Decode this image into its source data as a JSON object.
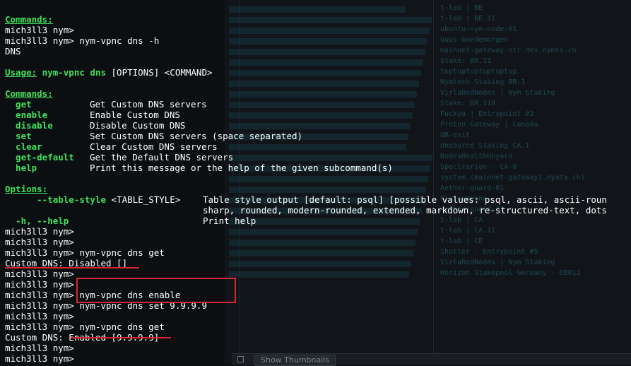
{
  "terminal": {
    "prompt": "mich3ll3 nym>",
    "lines": [
      {
        "kind": "heading",
        "text": "Commands:"
      },
      {
        "kind": "prompt",
        "cmd": ""
      },
      {
        "kind": "prompt",
        "cmd": " nym-vpnc dns -h"
      },
      {
        "kind": "text",
        "text": "DNS"
      },
      {
        "kind": "blank"
      },
      {
        "kind": "usage",
        "label": "Usage:",
        "bold": " nym-vpnc dns",
        "rest": " [OPTIONS] <COMMAND>"
      },
      {
        "kind": "blank"
      },
      {
        "kind": "heading",
        "text": "Commands:"
      },
      {
        "kind": "command",
        "name": "  get",
        "desc": "Get Custom DNS servers"
      },
      {
        "kind": "command",
        "name": "  enable",
        "desc": "Enable Custom DNS"
      },
      {
        "kind": "command",
        "name": "  disable",
        "desc": "Disable Custom DNS"
      },
      {
        "kind": "command",
        "name": "  set",
        "desc": "Set Custom DNS servers (space separated)"
      },
      {
        "kind": "command",
        "name": "  clear",
        "desc": "Clear Custom DNS servers"
      },
      {
        "kind": "command",
        "name": "  get-default",
        "desc": "Get the Default DNS servers"
      },
      {
        "kind": "command",
        "name": "  help",
        "desc": "Print this message or the help of the given subcommand(s)"
      },
      {
        "kind": "blank"
      },
      {
        "kind": "heading",
        "text": "Options:"
      },
      {
        "kind": "option",
        "name": "      --table-style",
        "arg": " <TABLE_STYLE>",
        "desc": "Table style output [default: psql] [possible values: psql, ascii, ascii-roun"
      },
      {
        "kind": "continuation",
        "text": "sharp, rounded, modern-rounded, extended, markdown, re-structured-text, dots"
      },
      {
        "kind": "option",
        "name": "  -h, --help",
        "arg": "",
        "desc": "Print help"
      },
      {
        "kind": "prompt",
        "cmd": ""
      },
      {
        "kind": "prompt",
        "cmd": ""
      },
      {
        "kind": "prompt",
        "cmd": " nym-vpnc dns get"
      },
      {
        "kind": "text",
        "text": "Custom DNS: Disabled []"
      },
      {
        "kind": "prompt",
        "cmd": ""
      },
      {
        "kind": "prompt",
        "cmd": ""
      },
      {
        "kind": "prompt",
        "cmd": " nym-vpnc dns enable"
      },
      {
        "kind": "prompt",
        "cmd": " nym-vpnc dns set 9.9.9.9"
      },
      {
        "kind": "prompt",
        "cmd": ""
      },
      {
        "kind": "prompt",
        "cmd": " nym-vpnc dns get"
      },
      {
        "kind": "text",
        "text": "Custom DNS: Enabled [9.9.9.9]"
      },
      {
        "kind": "prompt",
        "cmd": ""
      },
      {
        "kind": "prompt",
        "cmd": ""
      }
    ]
  },
  "background": {
    "thumbnails_label": "Show Thumbnails",
    "rows": [
      "t-lab | BE",
      "t-lab | BE.II",
      "ubuntu-nym-node-01",
      "Guus Goedemorgen",
      "mainnet-gateway-ntr.dev.nymte.ch",
      "Stake: BR.II",
      "tuptuptuptuptuptup",
      "Nymtech Staking BR.1",
      "VirlaRedNodes | Nym Staking",
      "Stake: BR.118",
      "Fuckya | Entrypoint #3",
      "Proton Gateway | Canada",
      "GR-exit",
      "Unsource Staking CA.1",
      "NodesHealthUnyard",
      "Spectrarion - CA-0",
      "system.(mainnet-gateway1.nyata.ch)",
      "Aether-guard-01",
      "Pistondrone",
      "Aether-guard-02",
      "t-lab | CA",
      "t-lab | CA.II",
      "t-lab | CE",
      "Shutter - Entrypoint #5",
      "VirlaRedNodes | Nym Staking",
      "Horizon Stakepool Germany - DE012"
    ]
  },
  "colors": {
    "green": "#3fe05a",
    "annotation_red": "#d8262e",
    "background": "#0c0f12"
  }
}
